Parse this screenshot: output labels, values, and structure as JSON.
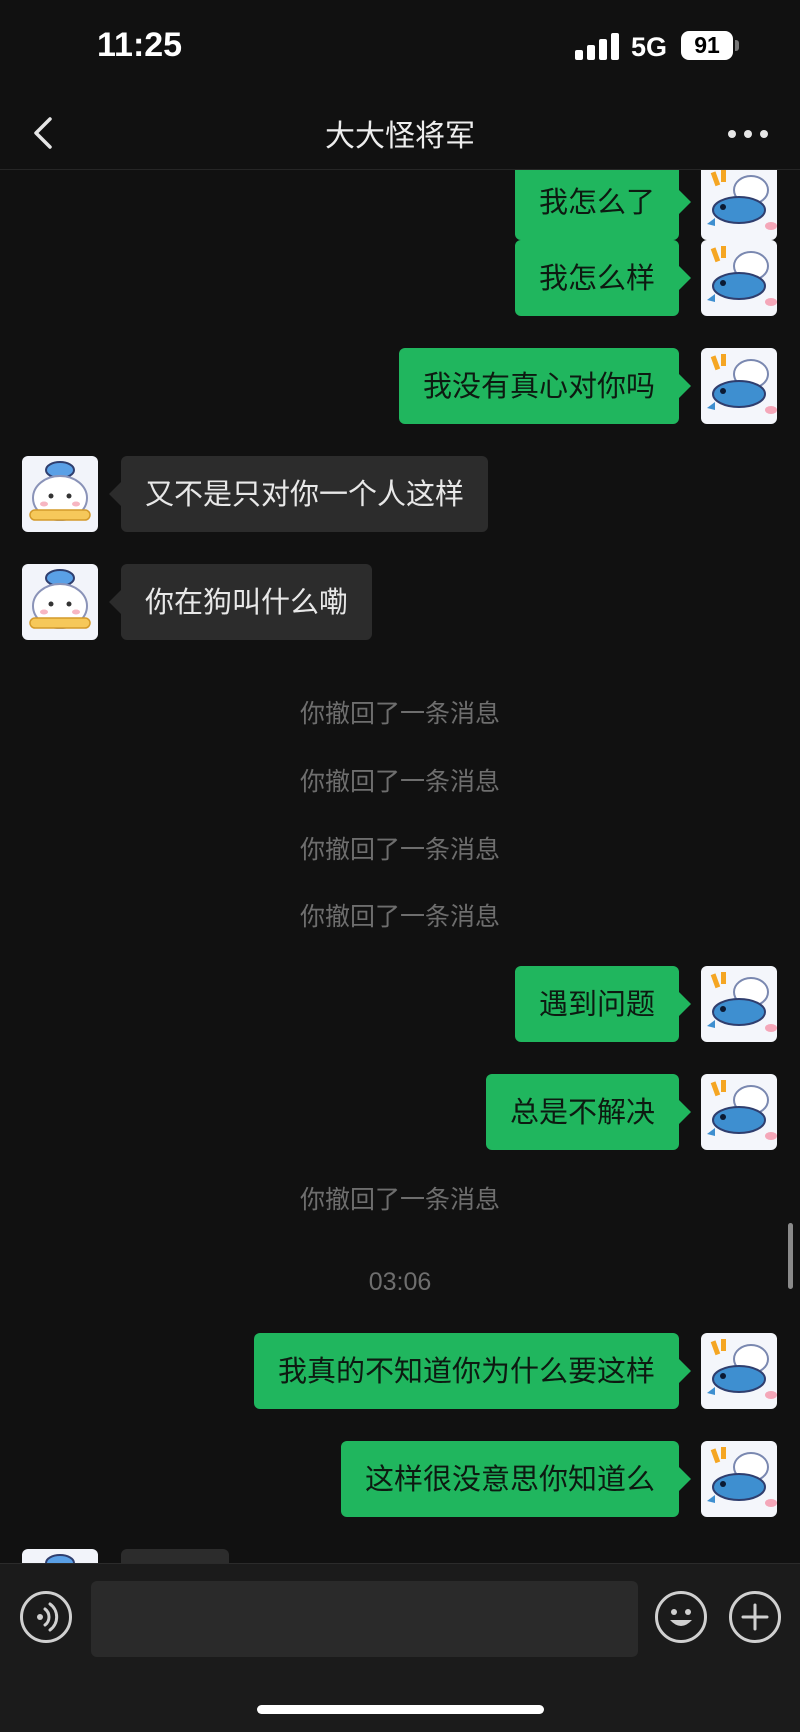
{
  "status_bar": {
    "time": "11:25",
    "network": "5G",
    "battery": "91"
  },
  "nav": {
    "title": "大大怪将军"
  },
  "messages": [
    {
      "kind": "me",
      "text": "我怎么了"
    },
    {
      "kind": "me",
      "text": "我怎么样"
    },
    {
      "kind": "me",
      "text": "我没有真心对你吗"
    },
    {
      "kind": "peer",
      "text": "又不是只对你一个人这样"
    },
    {
      "kind": "peer",
      "text": "你在狗叫什么嘞"
    },
    {
      "kind": "system",
      "text": "你撤回了一条消息"
    },
    {
      "kind": "system",
      "text": "你撤回了一条消息"
    },
    {
      "kind": "system",
      "text": "你撤回了一条消息"
    },
    {
      "kind": "system",
      "text": "你撤回了一条消息"
    },
    {
      "kind": "me",
      "text": "遇到问题"
    },
    {
      "kind": "me",
      "text": "总是不解决"
    },
    {
      "kind": "system",
      "text": "你撤回了一条消息"
    },
    {
      "kind": "timestamp",
      "text": "03:06"
    },
    {
      "kind": "me",
      "text": "我真的不知道你为什么要这样"
    },
    {
      "kind": "me",
      "text": "这样很没意思你知道么"
    }
  ],
  "colors": {
    "my_bubble": "#20b65e",
    "peer_bubble": "#2c2c2c",
    "background": "#111111"
  },
  "icons": [
    "back-chevron-icon",
    "more-dots-icon",
    "voice-icon",
    "emoji-icon",
    "plus-icon"
  ]
}
